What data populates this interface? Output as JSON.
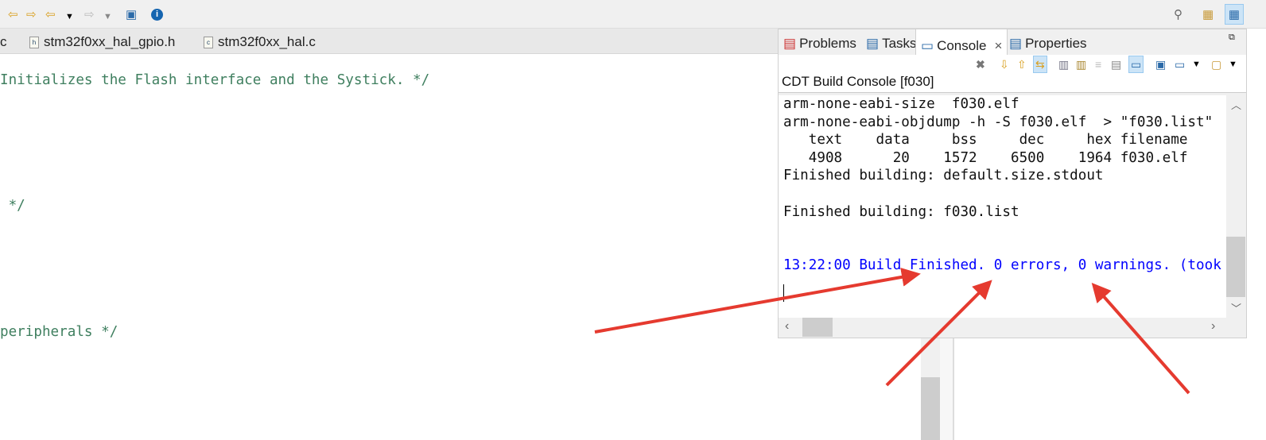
{
  "toolbar": {
    "icons": [
      "prev-edit-icon",
      "next-edit-icon",
      "back-icon",
      "dropdown-icon",
      "forward-icon",
      "dropdown-icon",
      "open-task-icon",
      "info-icon",
      "search-icon",
      "open-perspective-icon",
      "c-perspective-icon"
    ]
  },
  "editor": {
    "tabs": [
      {
        "label": "c"
      },
      {
        "label": "stm32f0xx_hal_gpio.h",
        "icon": "h"
      },
      {
        "label": "stm32f0xx_hal.c",
        "icon": "c"
      }
    ],
    "lines": [
      "Initializes the Flash interface and the Systick. */",
      " */",
      "peripherals */"
    ]
  },
  "panel": {
    "tabs": [
      {
        "label": "Problems"
      },
      {
        "label": "Tasks"
      },
      {
        "label": "Console",
        "close": "×"
      },
      {
        "label": "Properties"
      }
    ],
    "console_title": "CDT Build Console [f030]",
    "console_lines": [
      "arm-none-eabi-size  f030.elf",
      "arm-none-eabi-objdump -h -S f030.elf  > \"f030.list\"",
      "   text    data     bss     dec     hex filename",
      "   4908      20    1572    6500    1964 f030.elf",
      "Finished building: default.size.stdout",
      "",
      "Finished building: f030.list",
      "",
      ""
    ],
    "build_result": "13:22:00 Build Finished. 0 errors, 0 warnings. (took",
    "colors": {
      "build_result": "#0000ff",
      "annotation_arrow": "#e53a2f"
    }
  }
}
